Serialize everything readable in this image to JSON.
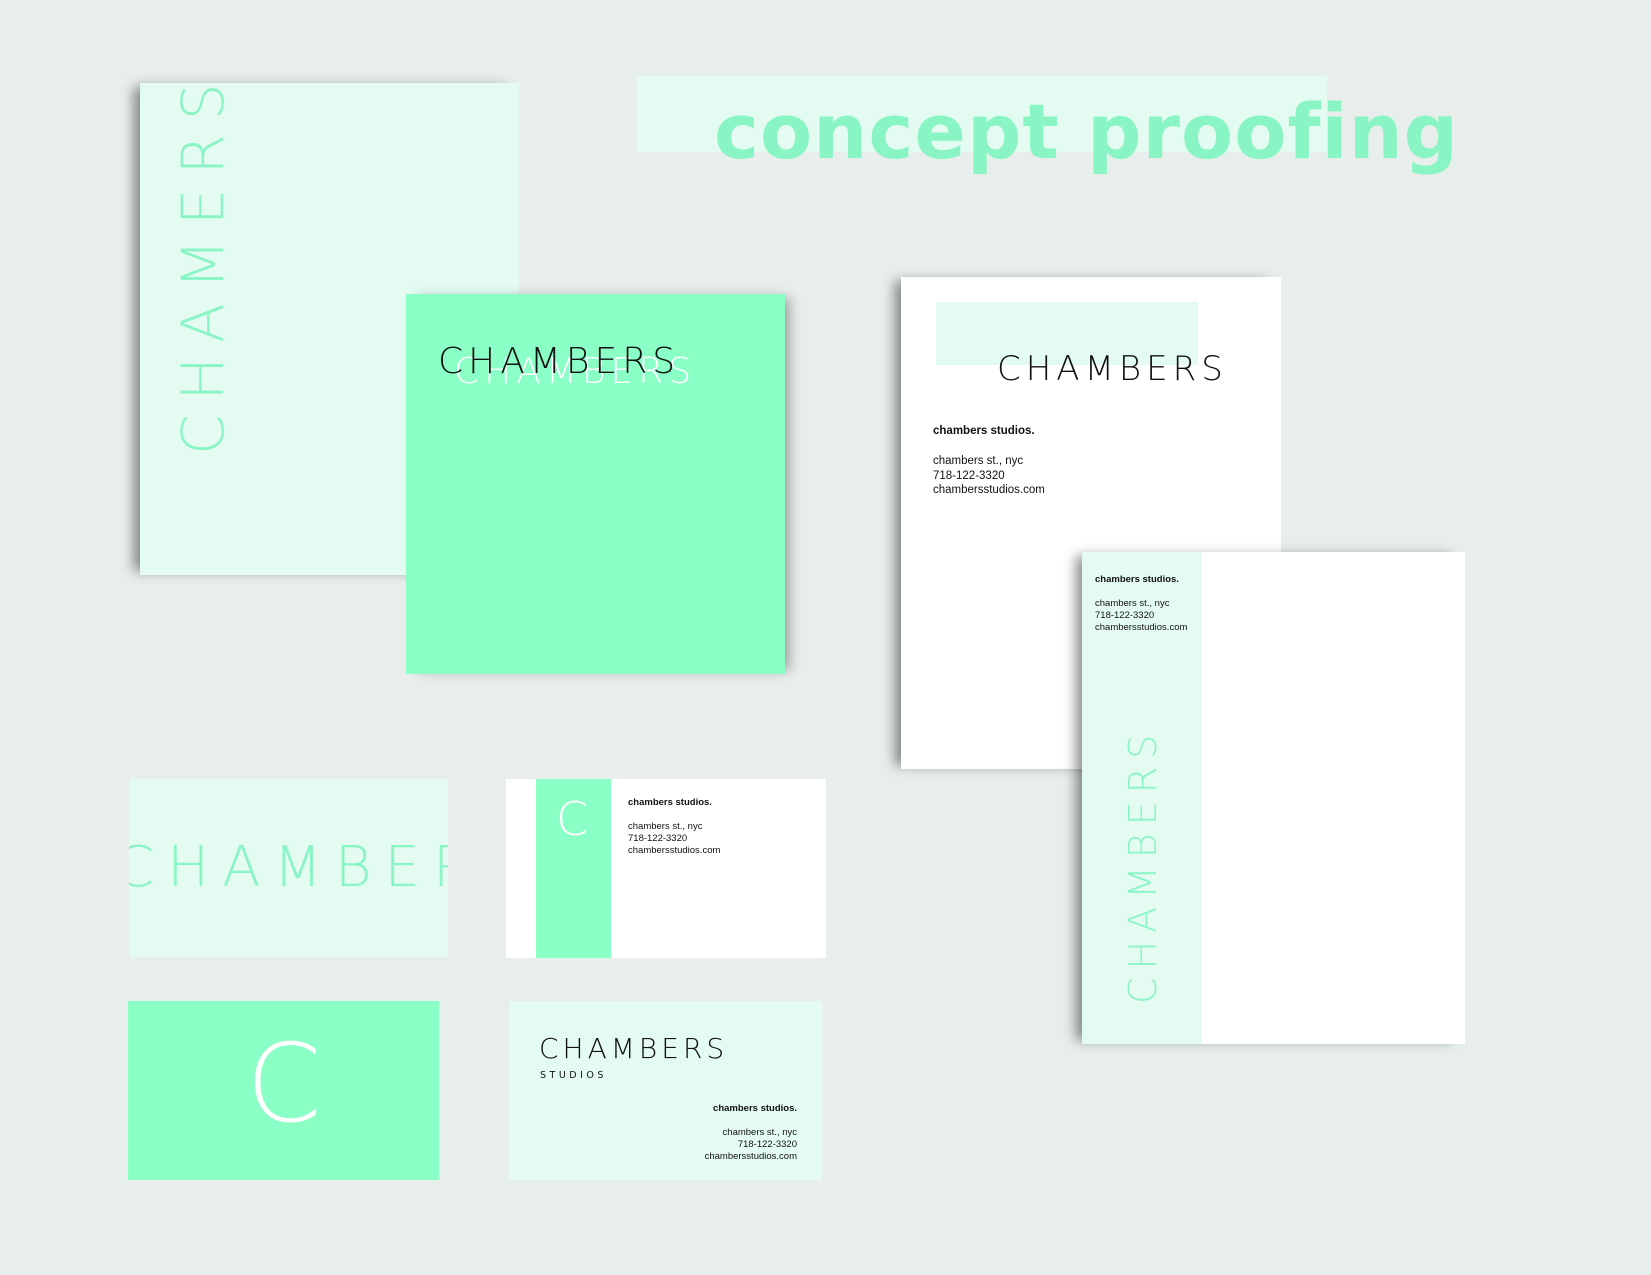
{
  "page": {
    "title": "concept proofing"
  },
  "brand": {
    "name": "CHAMBERS",
    "name_vertical": "CHAMERS",
    "name_echo": "CHAMBERS",
    "name_cropped": "CHAMBERS",
    "subline": "STUDIOS",
    "monogram": "C"
  },
  "contact": {
    "company": "chambers studios.",
    "address": "chambers st., nyc",
    "phone": "718-122-3320",
    "web": "chambersstudios.com"
  },
  "colors": {
    "background": "#e8eeeb",
    "mint": "#8affc6",
    "pale_mint": "#e4fbf2",
    "title_mint": "#8af5c4",
    "ink": "#111111",
    "white": "#ffffff"
  }
}
